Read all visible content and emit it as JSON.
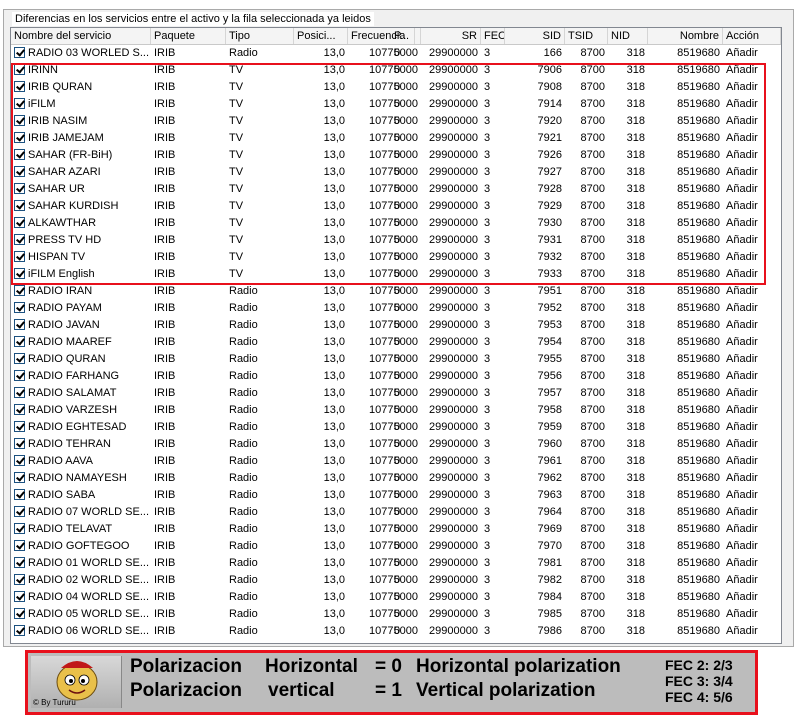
{
  "group_title": "Diferencias en los servicios entre el activo y la fila seleccionada ya leidos",
  "columns": [
    "Nombre del servicio",
    "Paquete",
    "Tipo",
    "Posici...",
    "Frecuencia",
    "P...",
    "SR",
    "FEC",
    "SID",
    "TSID",
    "NID",
    "Nombre",
    "Acción"
  ],
  "rows": [
    [
      "RADIO 03 WORLED S...",
      "IRIB",
      "Radio",
      "13,0",
      "10775000",
      "0",
      "29900000",
      "3",
      "166",
      "8700",
      "318",
      "8519680",
      "Añadir"
    ],
    [
      "IRINN",
      "IRIB",
      "TV",
      "13,0",
      "10775000",
      "0",
      "29900000",
      "3",
      "7906",
      "8700",
      "318",
      "8519680",
      "Añadir"
    ],
    [
      "IRIB QURAN",
      "IRIB",
      "TV",
      "13,0",
      "10775000",
      "0",
      "29900000",
      "3",
      "7908",
      "8700",
      "318",
      "8519680",
      "Añadir"
    ],
    [
      "iFILM",
      "IRIB",
      "TV",
      "13,0",
      "10775000",
      "0",
      "29900000",
      "3",
      "7914",
      "8700",
      "318",
      "8519680",
      "Añadir"
    ],
    [
      "IRIB NASIM",
      "IRIB",
      "TV",
      "13,0",
      "10775000",
      "0",
      "29900000",
      "3",
      "7920",
      "8700",
      "318",
      "8519680",
      "Añadir"
    ],
    [
      "IRIB JAMEJAM",
      "IRIB",
      "TV",
      "13,0",
      "10775000",
      "0",
      "29900000",
      "3",
      "7921",
      "8700",
      "318",
      "8519680",
      "Añadir"
    ],
    [
      "SAHAR (FR-BiH)",
      "IRIB",
      "TV",
      "13,0",
      "10775000",
      "0",
      "29900000",
      "3",
      "7926",
      "8700",
      "318",
      "8519680",
      "Añadir"
    ],
    [
      "SAHAR AZARI",
      "IRIB",
      "TV",
      "13,0",
      "10775000",
      "0",
      "29900000",
      "3",
      "7927",
      "8700",
      "318",
      "8519680",
      "Añadir"
    ],
    [
      "SAHAR UR",
      "IRIB",
      "TV",
      "13,0",
      "10775000",
      "0",
      "29900000",
      "3",
      "7928",
      "8700",
      "318",
      "8519680",
      "Añadir"
    ],
    [
      "SAHAR KURDISH",
      "IRIB",
      "TV",
      "13,0",
      "10775000",
      "0",
      "29900000",
      "3",
      "7929",
      "8700",
      "318",
      "8519680",
      "Añadir"
    ],
    [
      "ALKAWTHAR",
      "IRIB",
      "TV",
      "13,0",
      "10775000",
      "0",
      "29900000",
      "3",
      "7930",
      "8700",
      "318",
      "8519680",
      "Añadir"
    ],
    [
      "PRESS TV HD",
      "IRIB",
      "TV",
      "13,0",
      "10775000",
      "0",
      "29900000",
      "3",
      "7931",
      "8700",
      "318",
      "8519680",
      "Añadir"
    ],
    [
      "HISPAN TV",
      "IRIB",
      "TV",
      "13,0",
      "10775000",
      "0",
      "29900000",
      "3",
      "7932",
      "8700",
      "318",
      "8519680",
      "Añadir"
    ],
    [
      "iFILM English",
      "IRIB",
      "TV",
      "13,0",
      "10775000",
      "0",
      "29900000",
      "3",
      "7933",
      "8700",
      "318",
      "8519680",
      "Añadir"
    ],
    [
      "RADIO IRAN",
      "IRIB",
      "Radio",
      "13,0",
      "10775000",
      "0",
      "29900000",
      "3",
      "7951",
      "8700",
      "318",
      "8519680",
      "Añadir"
    ],
    [
      "RADIO PAYAM",
      "IRIB",
      "Radio",
      "13,0",
      "10775000",
      "0",
      "29900000",
      "3",
      "7952",
      "8700",
      "318",
      "8519680",
      "Añadir"
    ],
    [
      "RADIO JAVAN",
      "IRIB",
      "Radio",
      "13,0",
      "10775000",
      "0",
      "29900000",
      "3",
      "7953",
      "8700",
      "318",
      "8519680",
      "Añadir"
    ],
    [
      "RADIO MAAREF",
      "IRIB",
      "Radio",
      "13,0",
      "10775000",
      "0",
      "29900000",
      "3",
      "7954",
      "8700",
      "318",
      "8519680",
      "Añadir"
    ],
    [
      "RADIO QURAN",
      "IRIB",
      "Radio",
      "13,0",
      "10775000",
      "0",
      "29900000",
      "3",
      "7955",
      "8700",
      "318",
      "8519680",
      "Añadir"
    ],
    [
      "RADIO FARHANG",
      "IRIB",
      "Radio",
      "13,0",
      "10775000",
      "0",
      "29900000",
      "3",
      "7956",
      "8700",
      "318",
      "8519680",
      "Añadir"
    ],
    [
      "RADIO SALAMAT",
      "IRIB",
      "Radio",
      "13,0",
      "10775000",
      "0",
      "29900000",
      "3",
      "7957",
      "8700",
      "318",
      "8519680",
      "Añadir"
    ],
    [
      "RADIO VARZESH",
      "IRIB",
      "Radio",
      "13,0",
      "10775000",
      "0",
      "29900000",
      "3",
      "7958",
      "8700",
      "318",
      "8519680",
      "Añadir"
    ],
    [
      "RADIO EGHTESAD",
      "IRIB",
      "Radio",
      "13,0",
      "10775000",
      "0",
      "29900000",
      "3",
      "7959",
      "8700",
      "318",
      "8519680",
      "Añadir"
    ],
    [
      "RADIO TEHRAN",
      "IRIB",
      "Radio",
      "13,0",
      "10775000",
      "0",
      "29900000",
      "3",
      "7960",
      "8700",
      "318",
      "8519680",
      "Añadir"
    ],
    [
      "RADIO AAVA",
      "IRIB",
      "Radio",
      "13,0",
      "10775000",
      "0",
      "29900000",
      "3",
      "7961",
      "8700",
      "318",
      "8519680",
      "Añadir"
    ],
    [
      "RADIO NAMAYESH",
      "IRIB",
      "Radio",
      "13,0",
      "10775000",
      "0",
      "29900000",
      "3",
      "7962",
      "8700",
      "318",
      "8519680",
      "Añadir"
    ],
    [
      "RADIO SABA",
      "IRIB",
      "Radio",
      "13,0",
      "10775000",
      "0",
      "29900000",
      "3",
      "7963",
      "8700",
      "318",
      "8519680",
      "Añadir"
    ],
    [
      "RADIO 07 WORLD SE...",
      "IRIB",
      "Radio",
      "13,0",
      "10775000",
      "0",
      "29900000",
      "3",
      "7964",
      "8700",
      "318",
      "8519680",
      "Añadir"
    ],
    [
      "RADIO TELAVAT",
      "IRIB",
      "Radio",
      "13,0",
      "10775000",
      "0",
      "29900000",
      "3",
      "7969",
      "8700",
      "318",
      "8519680",
      "Añadir"
    ],
    [
      "RADIO GOFTEGOO",
      "IRIB",
      "Radio",
      "13,0",
      "10775000",
      "0",
      "29900000",
      "3",
      "7970",
      "8700",
      "318",
      "8519680",
      "Añadir"
    ],
    [
      "RADIO 01 WORLD SE...",
      "IRIB",
      "Radio",
      "13,0",
      "10775000",
      "0",
      "29900000",
      "3",
      "7981",
      "8700",
      "318",
      "8519680",
      "Añadir"
    ],
    [
      "RADIO 02 WORLD SE...",
      "IRIB",
      "Radio",
      "13,0",
      "10775000",
      "0",
      "29900000",
      "3",
      "7982",
      "8700",
      "318",
      "8519680",
      "Añadir"
    ],
    [
      "RADIO 04 WORLD SE...",
      "IRIB",
      "Radio",
      "13,0",
      "10775000",
      "0",
      "29900000",
      "3",
      "7984",
      "8700",
      "318",
      "8519680",
      "Añadir"
    ],
    [
      "RADIO 05 WORLD SE...",
      "IRIB",
      "Radio",
      "13,0",
      "10775000",
      "0",
      "29900000",
      "3",
      "7985",
      "8700",
      "318",
      "8519680",
      "Añadir"
    ],
    [
      "RADIO 06 WORLD SE...",
      "IRIB",
      "Radio",
      "13,0",
      "10775000",
      "0",
      "29900000",
      "3",
      "7986",
      "8700",
      "318",
      "8519680",
      "Añadir"
    ]
  ],
  "legend": {
    "credit": "© By Tururu",
    "line1": {
      "label": "Polarizacion",
      "mode": "Horizontal",
      "eq": "= 0",
      "desc": "Horizontal polarization"
    },
    "line2": {
      "label": "Polarizacion",
      "mode": "vertical",
      "eq": "= 1",
      "desc": "Vertical polarization"
    },
    "fec": [
      "FEC 2: 2/3",
      "FEC 3: 3/4",
      "FEC 4: 5/6"
    ]
  },
  "colors": {
    "highlight_border": "#e8101c",
    "legend_bg": "#bcbcbc"
  }
}
